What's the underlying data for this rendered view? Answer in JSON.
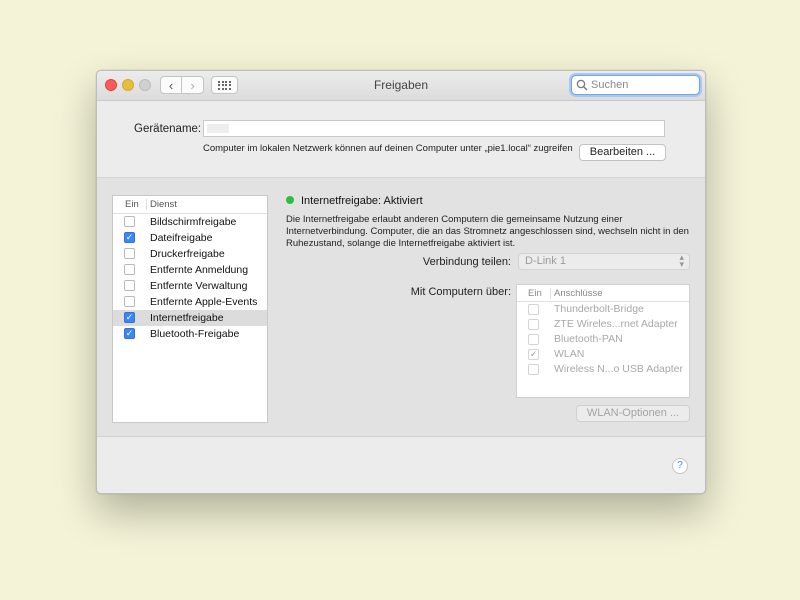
{
  "window": {
    "title": "Freigaben"
  },
  "search": {
    "placeholder": "Suchen"
  },
  "device": {
    "label": "Gerätename:",
    "name_value": "",
    "hint": "Computer im lokalen Netzwerk können auf deinen Computer unter „pie1.local“ zugreifen",
    "edit_button": "Bearbeiten ..."
  },
  "services": {
    "header_on": "Ein",
    "header_service": "Dienst",
    "items": [
      {
        "label": "Bildschirmfreigabe",
        "checked": false,
        "selected": false
      },
      {
        "label": "Dateifreigabe",
        "checked": true,
        "selected": false
      },
      {
        "label": "Druckerfreigabe",
        "checked": false,
        "selected": false
      },
      {
        "label": "Entfernte Anmeldung",
        "checked": false,
        "selected": false
      },
      {
        "label": "Entfernte Verwaltung",
        "checked": false,
        "selected": false
      },
      {
        "label": "Entfernte Apple-Events",
        "checked": false,
        "selected": false
      },
      {
        "label": "Internetfreigabe",
        "checked": true,
        "selected": true
      },
      {
        "label": "Bluetooth-Freigabe",
        "checked": true,
        "selected": false
      }
    ]
  },
  "detail": {
    "status": "Internetfreigabe: Aktiviert",
    "status_color": "#2fbd41",
    "description": "Die Internetfreigabe erlaubt anderen Computern die gemeinsame Nutzung einer Internetverbindung. Computer, die an das Stromnetz angeschlossen sind, wechseln nicht in den Ruhezustand, solange die Internetfreigabe aktiviert ist.",
    "share_label": "Verbindung teilen:",
    "share_value": "D-Link 1",
    "via_label": "Mit Computern über:",
    "ports_header_on": "Ein",
    "ports_header_name": "Anschlüsse",
    "ports": [
      {
        "label": "Thunderbolt-Bridge",
        "checked": false
      },
      {
        "label": "ZTE Wireles...rnet Adapter",
        "checked": false
      },
      {
        "label": "Bluetooth-PAN",
        "checked": false
      },
      {
        "label": "WLAN",
        "checked": true
      },
      {
        "label": "Wireless N...o USB Adapter",
        "checked": false
      }
    ],
    "wlan_button": "WLAN-Optionen ..."
  },
  "help": {
    "label": "?"
  },
  "colors": {
    "accent": "#3d86ee",
    "background": "#f4f3d7"
  }
}
